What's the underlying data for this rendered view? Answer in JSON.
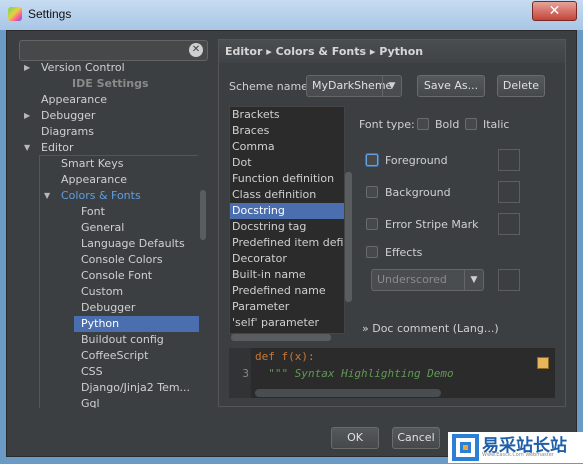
{
  "window": {
    "title": "Settings",
    "close_glyph": "✕"
  },
  "left": {
    "search_clear_glyph": "✕",
    "tree": [
      {
        "label": "Version Control",
        "arrow": "▶"
      },
      {
        "label": "IDE Settings",
        "header": true
      },
      {
        "label": "Appearance"
      },
      {
        "label": "Debugger",
        "arrow": "▶"
      },
      {
        "label": "Diagrams"
      },
      {
        "label": "Editor",
        "arrow": "▼"
      },
      {
        "label": "Smart Keys"
      },
      {
        "label": "Appearance"
      },
      {
        "label": "Colors & Fonts",
        "arrow": "▼",
        "highlight": true
      },
      {
        "label": "Font"
      },
      {
        "label": "General"
      },
      {
        "label": "Language Defaults"
      },
      {
        "label": "Console Colors"
      },
      {
        "label": "Console Font"
      },
      {
        "label": "Custom"
      },
      {
        "label": "Debugger"
      },
      {
        "label": "Python",
        "selected": true
      },
      {
        "label": "Buildout config"
      },
      {
        "label": "CoffeeScript"
      },
      {
        "label": "CSS"
      },
      {
        "label": "Django/Jinja2 Tem..."
      },
      {
        "label": "Gql"
      }
    ]
  },
  "right": {
    "breadcrumb": "Editor ▸ Colors & Fonts ▸ Python",
    "scheme_label": "Scheme name:",
    "scheme_value": "MyDarkSheme",
    "save_as": "Save As...",
    "delete": "Delete",
    "elements": [
      "Brackets",
      "Braces",
      "Comma",
      "Dot",
      "Function definition",
      "Class definition",
      "Docstring",
      "Docstring tag",
      "Predefined item definition",
      "Decorator",
      "Built-in name",
      "Predefined name",
      "Parameter",
      "'self' parameter"
    ],
    "selected_element": "Docstring",
    "font_type_label": "Font type:",
    "bold": "Bold",
    "italic": "Italic",
    "foreground": "Foreground",
    "background": "Background",
    "error_stripe": "Error Stripe Mark",
    "effects": "Effects",
    "effect_type": "Underscored",
    "doc_comment": "» Doc comment (Lang...)"
  },
  "editor": {
    "lines": [
      {
        "num": "",
        "text": "def f(x):"
      },
      {
        "num": "3",
        "text": "  \"\"\" Syntax Highlighting Demo"
      }
    ],
    "keyword_color": "#cc7832",
    "docstring_color": "#629755",
    "marker_color": "#e8b658"
  },
  "footer": {
    "ok": "OK",
    "cancel": "Cancel"
  },
  "watermark": {
    "brand": "易采站长站",
    "sub": "Www.Easck.Com Webmaster"
  },
  "colors": {
    "selection": "#4b6eaf",
    "accent": "#5f9ee0",
    "background": "#3c3f41"
  }
}
